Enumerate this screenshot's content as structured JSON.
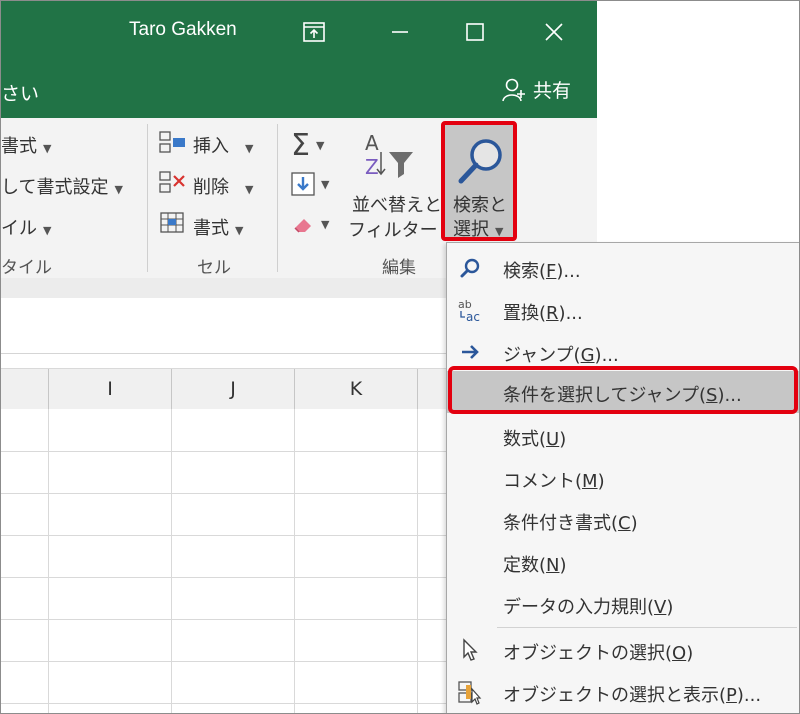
{
  "window": {
    "user": "Taro Gakken"
  },
  "tellme": {
    "text": "さい",
    "share_label": "共有"
  },
  "ribbon": {
    "styles": {
      "row1": "書式",
      "row2": "して書式設定",
      "row3": "イル",
      "group": "タイル"
    },
    "cells": {
      "insert": "挿入",
      "delete": "削除",
      "format": "書式",
      "group": "セル"
    },
    "editing": {
      "sort_line1": "並べ替えと",
      "sort_line2": "フィルター",
      "group": "編集"
    },
    "find": {
      "line1": "検索と",
      "line2": "選択"
    }
  },
  "columns": [
    "I",
    "J",
    "K"
  ],
  "menu": {
    "items": [
      {
        "label": "検索(F)...",
        "icon": "magnifier-icon"
      },
      {
        "label": "置換(R)...",
        "icon": "replace-icon"
      },
      {
        "label": "ジャンプ(G)...",
        "icon": "arrow-right-icon"
      },
      {
        "label": "条件を選択してジャンプ(S)...",
        "icon": ""
      },
      {
        "label": "数式(U)",
        "icon": ""
      },
      {
        "label": "コメント(M)",
        "icon": ""
      },
      {
        "label": "条件付き書式(C)",
        "icon": ""
      },
      {
        "label": "定数(N)",
        "icon": ""
      },
      {
        "label": "データの入力規則(V)",
        "icon": ""
      },
      {
        "label": "オブジェクトの選択(O)",
        "icon": "cursor-icon"
      },
      {
        "label": "オブジェクトの選択と表示(P)...",
        "icon": "selection-pane-icon"
      }
    ]
  },
  "colors": {
    "excel_green": "#217346",
    "highlight_red": "#e3000f",
    "menu_hover": "#c6c6c6"
  }
}
